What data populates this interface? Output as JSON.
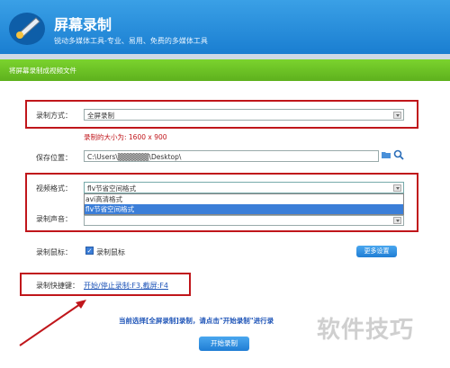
{
  "header": {
    "title": "屏幕录制",
    "subtitle": "锐动多媒体工具-专业、易用、免费的多媒体工具"
  },
  "banner": {
    "text": "将屏幕录制成视频文件"
  },
  "record_mode": {
    "label": "录制方式：",
    "value": "全屏录制",
    "size_text": "录制的大小为: 1600 x 900"
  },
  "save_location": {
    "label": "保存位置：",
    "value": "C:\\Users\\▒▒▒▒▒▒\\Desktop\\"
  },
  "video_format": {
    "label": "视频格式：",
    "value": "flv节省空间格式",
    "options": [
      "avi高清格式",
      "flv节省空间格式"
    ]
  },
  "audio": {
    "label": "录制声音：",
    "value": ""
  },
  "mouse": {
    "label": "录制鼠标：",
    "checkbox_label": "录制鼠标"
  },
  "more_settings": {
    "label": "更多设置"
  },
  "hotkey": {
    "label": "录制快捷键：",
    "value": "开始/停止录制:F3,截屏:F4"
  },
  "status": {
    "text": "当前选择[全屏录制]录制，请点击\"开始录制\"进行录"
  },
  "start_button": {
    "label": "开始录制"
  },
  "watermark": "软件技巧",
  "colors": {
    "accent": "#1f7dd4",
    "highlight": "#c0161b",
    "banner": "#6cc12a"
  }
}
